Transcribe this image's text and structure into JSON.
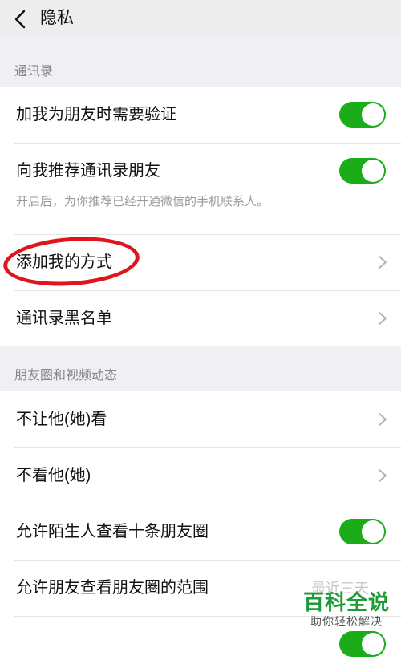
{
  "navbar": {
    "title": "隐私"
  },
  "sections": [
    {
      "header": "通讯录",
      "rows": [
        {
          "label": "加我为朋友时需要验证",
          "control": "toggle",
          "on": true
        },
        {
          "label": "向我推荐通讯录朋友",
          "sub": "开启后，为你推荐已经开通微信的手机联系人。",
          "control": "toggle",
          "on": true
        },
        {
          "label": "添加我的方式",
          "control": "chevron"
        },
        {
          "label": "通讯录黑名单",
          "control": "chevron"
        }
      ]
    },
    {
      "header": "朋友圈和视频动态",
      "rows": [
        {
          "label": "不让他(她)看",
          "control": "chevron"
        },
        {
          "label": "不看他(她)",
          "control": "chevron"
        },
        {
          "label": "允许陌生人查看十条朋友圈",
          "control": "toggle",
          "on": true
        },
        {
          "label": "允许朋友查看朋友圈的范围",
          "value": "最近三天",
          "control": "value"
        }
      ]
    }
  ],
  "watermark": {
    "title": "百科全说",
    "subtitle": "助你轻松解决"
  },
  "colors": {
    "toggle_on": "#1aad19",
    "highlight": "#e0141e",
    "watermark": "#1c9a35"
  }
}
